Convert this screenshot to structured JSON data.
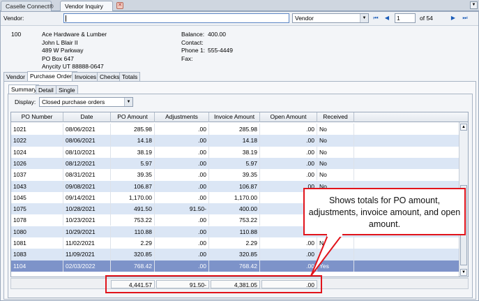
{
  "tabs": [
    {
      "label": "Caselle Connect®"
    },
    {
      "label": "Vendor Inquiry"
    }
  ],
  "toolbar": {
    "vendor_label": "Vendor:",
    "search_by": "Vendor",
    "page_value": "1",
    "page_of": "of 54"
  },
  "vendor": {
    "id": "100",
    "name": "Ace Hardware & Lumber",
    "contact_name": "John L Blair II",
    "address1": "489 W Parkway",
    "address2": "PO Box 647",
    "city_state_zip": "Anycity UT 88888-0647",
    "balance_label": "Balance:",
    "balance": "400.00",
    "contact_label": "Contact:",
    "contact": "",
    "phone_label": "Phone 1:",
    "phone": "555-4449",
    "fax_label": "Fax:",
    "fax": ""
  },
  "section_tabs": [
    "Vendor",
    "Purchase Orders",
    "Invoices",
    "Checks",
    "Totals"
  ],
  "view_tabs": [
    "Summary",
    "Detail",
    "Single"
  ],
  "display": {
    "label": "Display:",
    "value": "Closed purchase orders"
  },
  "table": {
    "columns": [
      "PO Number",
      "Date",
      "PO Amount",
      "Adjustments",
      "Invoice Amount",
      "Open Amount",
      "Received"
    ],
    "rows": [
      [
        "1021",
        "08/06/2021",
        "285.98",
        ".00",
        "285.98",
        ".00",
        "No"
      ],
      [
        "1022",
        "08/06/2021",
        "14.18",
        ".00",
        "14.18",
        ".00",
        "No"
      ],
      [
        "1024",
        "08/10/2021",
        "38.19",
        ".00",
        "38.19",
        ".00",
        "No"
      ],
      [
        "1026",
        "08/12/2021",
        "5.97",
        ".00",
        "5.97",
        ".00",
        "No"
      ],
      [
        "1037",
        "08/31/2021",
        "39.35",
        ".00",
        "39.35",
        ".00",
        "No"
      ],
      [
        "1043",
        "09/08/2021",
        "106.87",
        ".00",
        "106.87",
        ".00",
        "No"
      ],
      [
        "1045",
        "09/14/2021",
        "1,170.00",
        ".00",
        "1,170.00",
        "",
        ""
      ],
      [
        "1075",
        "10/28/2021",
        "491.50",
        "91.50-",
        "400.00",
        "",
        ""
      ],
      [
        "1078",
        "10/23/2021",
        "753.22",
        ".00",
        "753.22",
        "",
        ""
      ],
      [
        "1080",
        "10/29/2021",
        "110.88",
        ".00",
        "110.88",
        "",
        ""
      ],
      [
        "1081",
        "11/02/2021",
        "2.29",
        ".00",
        "2.29",
        ".00",
        "No"
      ],
      [
        "1083",
        "11/09/2021",
        "320.85",
        ".00",
        "320.85",
        ".00",
        "No"
      ],
      [
        "1104",
        "02/03/2022",
        "768.42",
        ".00",
        "768.42",
        ".00",
        "Yes"
      ]
    ],
    "selected_row": 12
  },
  "totals": {
    "po_amount": "4,441.57",
    "adjustments": "91.50-",
    "invoice_amount": "4,381.05",
    "open_amount": ".00"
  },
  "callout": {
    "text": "Shows totals for PO amount, adjustments, invoice amount, and open amount."
  },
  "colors": {
    "callout_border": "#e1141b",
    "selected_row": "#7d93c9",
    "alt_row": "#dbe6f5"
  }
}
